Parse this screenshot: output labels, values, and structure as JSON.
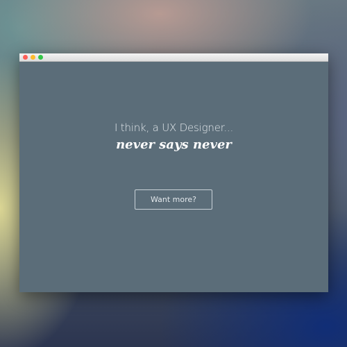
{
  "window": {
    "controls": [
      {
        "name": "close",
        "color": "#fc5f57"
      },
      {
        "name": "minimize",
        "color": "#fdbc2e"
      },
      {
        "name": "maximize",
        "color": "#33c748"
      }
    ],
    "background_color": "#5b6d79"
  },
  "hero": {
    "tagline": "I think, a UX Designer...",
    "headline": "never says never",
    "cta_label": "Want more?"
  }
}
